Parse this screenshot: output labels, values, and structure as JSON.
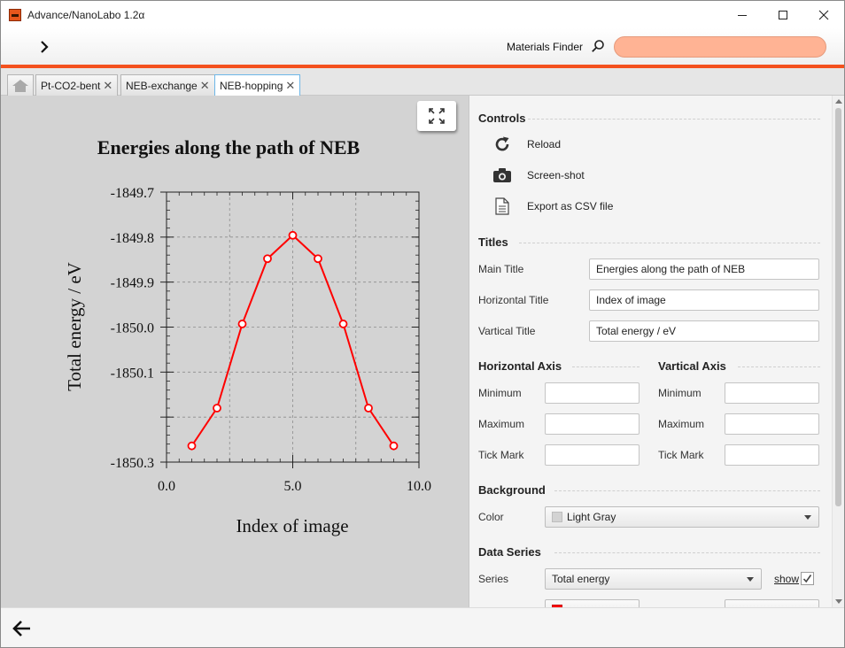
{
  "window": {
    "title": "Advance/NanoLabo 1.2α",
    "minimize_glyph": "—",
    "maximize_glyph": "☐",
    "close_glyph": "✕"
  },
  "toolbar": {
    "expand_glyph": "›",
    "materials_finder_label": "Materials Finder",
    "search_value": "",
    "search_icon": "search-icon"
  },
  "tabs": {
    "home_icon": "home-icon",
    "items": [
      {
        "label": "Pt-CO2-bent",
        "close": "✕"
      },
      {
        "label": "NEB-exchange",
        "close": "✕"
      },
      {
        "label": "NEB-hopping",
        "close": "✕"
      }
    ],
    "active_index": 2
  },
  "chart_data": {
    "type": "line",
    "title": "Energies along the path of NEB",
    "xlabel": "Index of image",
    "ylabel": "Total energy / eV",
    "xlim": [
      0.0,
      10.0
    ],
    "ylim": [
      -1850.3,
      -1849.7
    ],
    "x_ticks": [
      0.0,
      5.0,
      10.0
    ],
    "x_tick_labels": [
      "0.0",
      "5.0",
      "10.0"
    ],
    "x_minor_step": 0.5,
    "x_grid": [
      2.5,
      5.0,
      7.5
    ],
    "y_ticks": [
      -1849.7,
      -1849.8,
      -1849.9,
      -1850.0,
      -1850.1,
      -1850.2,
      -1850.3
    ],
    "y_tick_labels": [
      "-1849.7",
      "-1849.8",
      "-1849.9",
      "-1850.0",
      "-1850.1",
      "",
      "-1850.3"
    ],
    "y_minor_step": 0.02,
    "grid": true,
    "background": "#d3d3d3",
    "series": [
      {
        "name": "Total energy",
        "color": "#ff0000",
        "x": [
          1,
          2,
          3,
          4,
          5,
          6,
          7,
          8,
          9
        ],
        "y": [
          -1850.264,
          -1850.18,
          -1849.993,
          -1849.848,
          -1849.796,
          -1849.848,
          -1849.993,
          -1850.18,
          -1850.264
        ]
      }
    ]
  },
  "panel": {
    "controls": {
      "title": "Controls",
      "reload": {
        "label": "Reload",
        "icon": "reload-icon"
      },
      "screenshot": {
        "label": "Screen-shot",
        "icon": "camera-icon"
      },
      "export_csv": {
        "label": "Export as CSV file",
        "icon": "document-icon"
      }
    },
    "titles": {
      "title": "Titles",
      "main_label": "Main Title",
      "main_value": "Energies along the path of NEB",
      "horizontal_label": "Horizontal Title",
      "horizontal_value": "Index of image",
      "vertical_label": "Vartical Title",
      "vertical_value": "Total energy / eV"
    },
    "horizontal_axis": {
      "title": "Horizontal Axis",
      "minimum_label": "Minimum",
      "minimum_value": "",
      "maximum_label": "Maximum",
      "maximum_value": "",
      "tick_label": "Tick Mark",
      "tick_value": ""
    },
    "vertical_axis": {
      "title": "Vartical Axis",
      "minimum_label": "Minimum",
      "minimum_value": "",
      "maximum_label": "Maximum",
      "maximum_value": "",
      "tick_label": "Tick Mark",
      "tick_value": ""
    },
    "background": {
      "title": "Background",
      "color_label": "Color",
      "color_value": "Light Gray",
      "swatch_color": "#d3d3d3"
    },
    "data_series": {
      "title": "Data Series",
      "series_label": "Series",
      "series_value": "Total energy",
      "show_label": "show",
      "show_checked": true
    }
  },
  "bottom": {
    "back_icon": "back-arrow-icon"
  }
}
